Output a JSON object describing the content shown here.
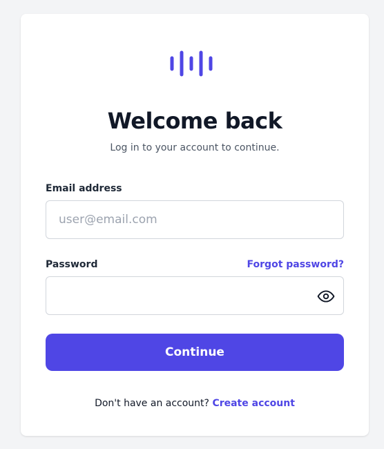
{
  "brand": {
    "logo_icon": "audio-waveform-icon",
    "accent_color": "#4f46e5"
  },
  "header": {
    "title": "Welcome back",
    "subtitle": "Log in to your account to continue."
  },
  "form": {
    "email": {
      "label": "Email address",
      "placeholder": "user@email.com",
      "value": ""
    },
    "password": {
      "label": "Password",
      "value": "",
      "toggle_icon": "eye-icon"
    },
    "forgot_password_label": "Forgot password?",
    "submit_label": "Continue"
  },
  "footer": {
    "prompt": "Don't have an account?",
    "link_label": "Create account"
  }
}
